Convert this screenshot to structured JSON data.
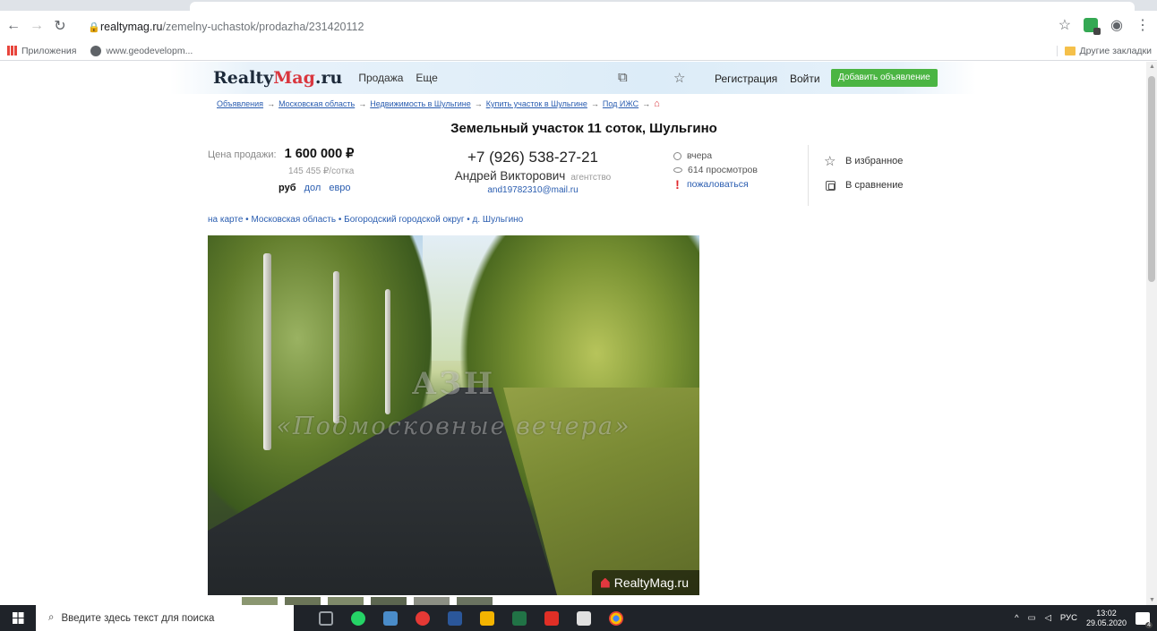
{
  "browser": {
    "url_host": "realtymag.ru",
    "url_path": "/zemelny-uchastok/prodazha/231420112",
    "bookmarks": [
      "Приложения",
      "www.geodevelopm..."
    ],
    "other_bookmarks": "Другие закладки"
  },
  "site": {
    "logo_main": "Realty",
    "logo_mag": "Mag",
    "logo_ru": ".ru",
    "nav": [
      "Продажа",
      "Еще"
    ],
    "register": "Регистрация",
    "login": "Войти",
    "add_listing": "Добавить объявление"
  },
  "breadcrumbs": [
    "Объявления",
    "Московская область",
    "Недвижимость в Шульгине",
    "Купить участок в Шульгине",
    "Под ИЖС"
  ],
  "listing": {
    "title": "Земельный участок 11 соток, Шульгино",
    "price_label": "Цена продажи:",
    "price": "1 600 000 ₽",
    "price_per": "145 455 ₽/сотка",
    "currency_active": "руб",
    "currency_options": [
      "дол",
      "евро"
    ],
    "phone": "+7 (926) 538-27-21",
    "agent": "Андрей Викторович",
    "agent_type": "агентство",
    "email": "and19782310@mail.ru",
    "posted": "вчера",
    "views": "614 просмотров",
    "complain": "пожаловаться",
    "favorite": "В избранное",
    "compare": "В сравнение",
    "location": "на карте • Московская область • Богородский городской округ • д. Шульгино"
  },
  "photo": {
    "watermark_top": "АЗН",
    "watermark_bottom": "«Подмосковные вечера»",
    "badge": "RealtyMag.ru"
  },
  "taskbar": {
    "search_placeholder": "Введите здесь текст для поиска",
    "lang": "РУС",
    "time": "13:02",
    "date": "29.05.2020",
    "notifications": "4"
  }
}
